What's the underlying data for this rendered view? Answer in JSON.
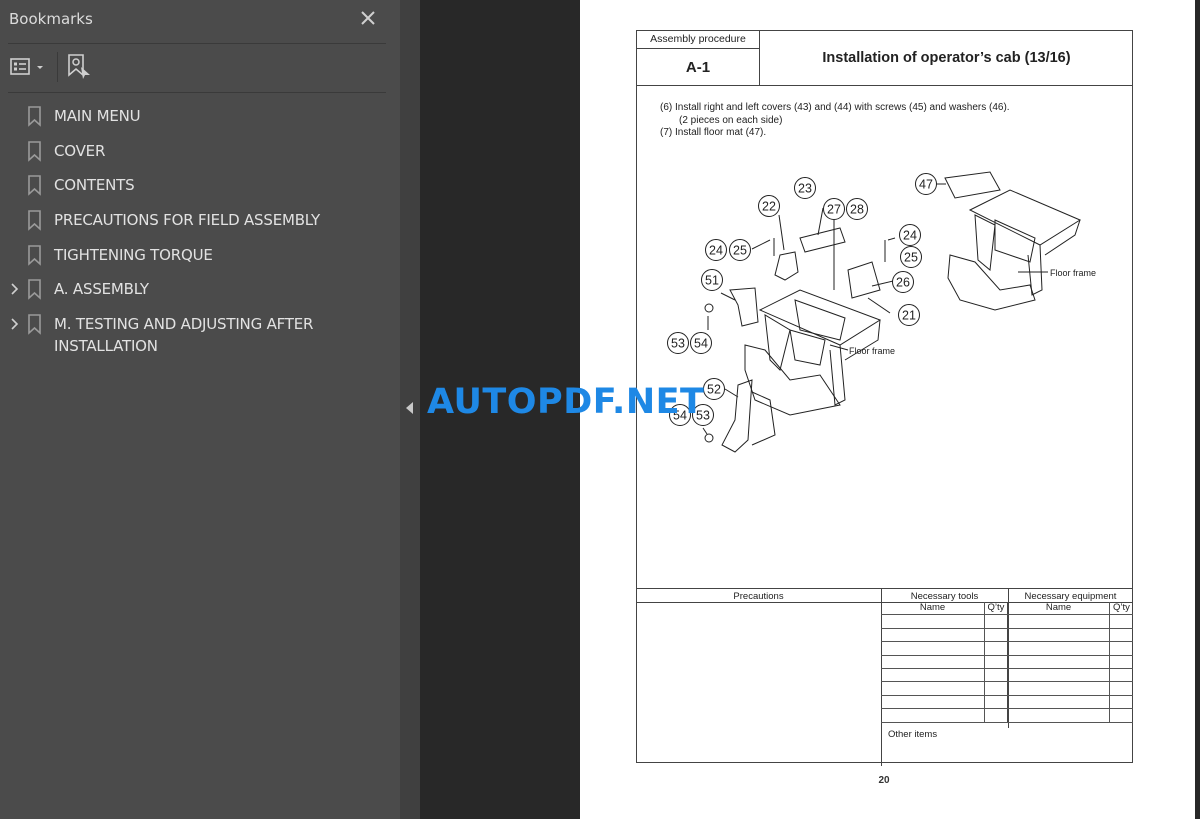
{
  "sidebar": {
    "title": "Bookmarks",
    "close_icon": "close-icon",
    "toolbar": {
      "options_icon": "list-options-icon",
      "add_bookmark_icon": "add-bookmark-icon"
    },
    "items": [
      {
        "label": "MAIN MENU",
        "expandable": false
      },
      {
        "label": "COVER",
        "expandable": false
      },
      {
        "label": "CONTENTS",
        "expandable": false
      },
      {
        "label": "PRECAUTIONS FOR FIELD ASSEMBLY",
        "expandable": false
      },
      {
        "label": "TIGHTENING TORQUE",
        "expandable": false
      },
      {
        "label": "A. ASSEMBLY",
        "expandable": true
      },
      {
        "label": "M. TESTING AND ADJUSTING AFTER INSTALLATION",
        "expandable": true
      }
    ]
  },
  "watermark": "AUTOPDF.NET",
  "document": {
    "header": {
      "label": "Assembly procedure",
      "code": "A-1",
      "title": "Installation of operator’s cab (13/16)"
    },
    "steps": [
      "(6)  Install right and left covers (43) and (44) with screws (45) and washers (46).",
      "(2 pieces on each side)",
      "(7) Install floor mat (47)."
    ],
    "diagram": {
      "callouts": [
        "22",
        "23",
        "27",
        "28",
        "24",
        "25",
        "24",
        "25",
        "26",
        "21",
        "51",
        "53",
        "54",
        "52",
        "54",
        "53",
        "47"
      ],
      "labels": [
        "Floor frame",
        "Floor frame"
      ]
    },
    "table": {
      "precautions": "Precautions",
      "tools": "Necessary tools",
      "equipment": "Necessary equipment",
      "name": "Name",
      "qty": "Q’ty",
      "other_items": "Other items"
    },
    "page_number": "20"
  },
  "colors": {
    "sidebar_bg": "#4b4b4b",
    "viewer_bg": "#282828",
    "watermark": "#1e88e5"
  }
}
